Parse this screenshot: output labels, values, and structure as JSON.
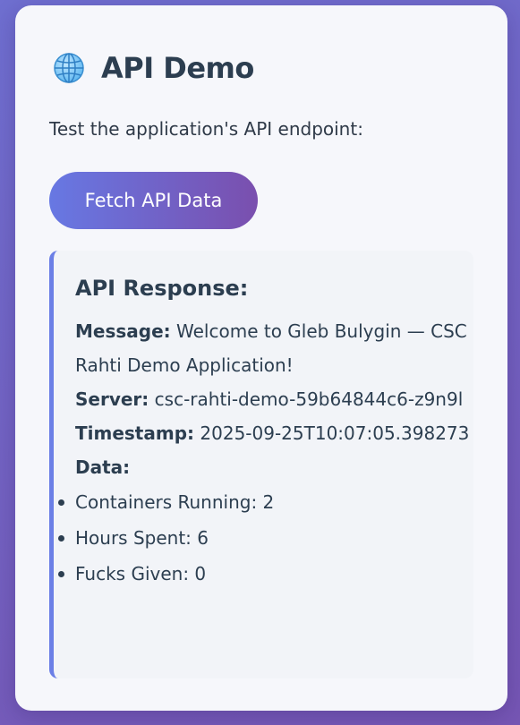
{
  "header": {
    "icon": "globe-icon",
    "title": "API Demo"
  },
  "intro_text": "Test the application's API endpoint:",
  "fetch_button_label": "Fetch API Data",
  "response": {
    "title": "API Response:",
    "message_label": "Message:",
    "message_value": "Welcome to Gleb Bulygin — CSC Rahti Demo Application!",
    "server_label": "Server:",
    "server_value": "csc-rahti-demo-59b64844c6-z9n9l",
    "timestamp_label": "Timestamp:",
    "timestamp_value": "2025-09-25T10:07:05.398273",
    "data_label": "Data:",
    "data_items": [
      "Containers Running: 2",
      "Hours Spent: 6",
      "Fucks Given: 0"
    ]
  },
  "colors": {
    "accent_start": "#6778e3",
    "accent_end": "#7a4fae",
    "response_border": "#6b7fe6",
    "text": "#2c3e50"
  }
}
